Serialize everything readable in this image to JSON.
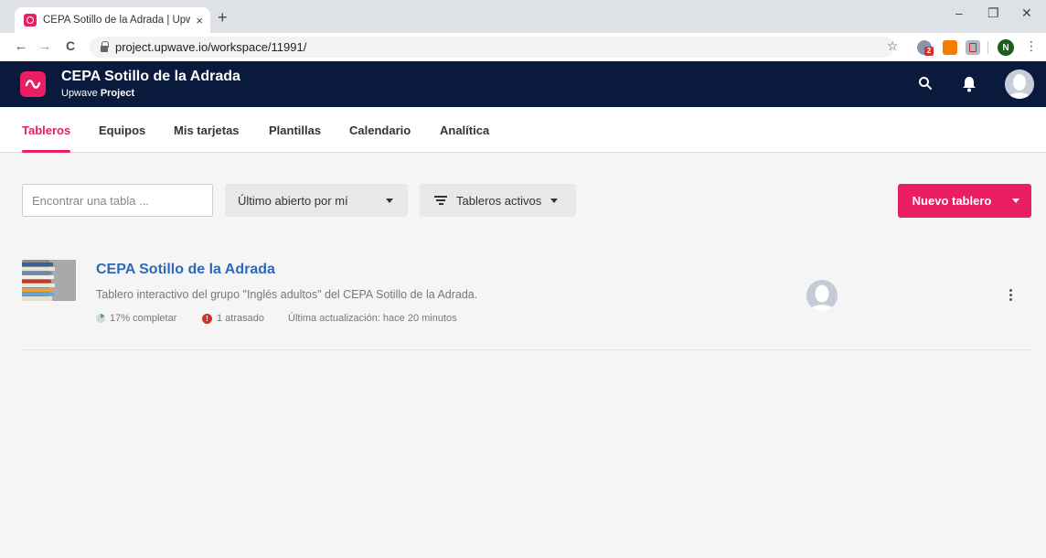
{
  "browser": {
    "tab_title": "CEPA Sotillo de la Adrada | Upwa",
    "tab_close": "×",
    "new_tab": "+",
    "url": "project.upwave.io/workspace/11991/",
    "back": "←",
    "forward": "→",
    "reload": "C",
    "star": "☆",
    "extension_badge": "2",
    "profile_initial": "N",
    "menu": "⋮",
    "minimize": "–",
    "restore": "❐",
    "close": "✕"
  },
  "header": {
    "workspace_name": "CEPA Sotillo de la Adrada",
    "product_prefix": "Upwave",
    "product_suffix": "Project",
    "accent_color": "#e91e63",
    "bar_color": "#0a1a3c"
  },
  "nav": {
    "tabs": [
      {
        "label": "Tableros",
        "active": true
      },
      {
        "label": "Equipos",
        "active": false
      },
      {
        "label": "Mis tarjetas",
        "active": false
      },
      {
        "label": "Plantillas",
        "active": false
      },
      {
        "label": "Calendario",
        "active": false
      },
      {
        "label": "Analítica",
        "active": false
      }
    ]
  },
  "toolbar": {
    "search_placeholder": "Encontrar una tabla ...",
    "sort_value": "Último abierto por mí",
    "filter_value": "Tableros activos",
    "new_board_label": "Nuevo tablero"
  },
  "boards": [
    {
      "title": "CEPA Sotillo de la Adrada",
      "description": "Tablero interactivo del grupo \"Inglés adultos\" del CEPA Sotillo de la Adrada.",
      "progress_text": "17% completar",
      "progress_fraction": 0.17,
      "late_text": "1 atrasado",
      "late_icon": "!",
      "updated_text": "Última actualización: hace 20 minutos"
    }
  ]
}
